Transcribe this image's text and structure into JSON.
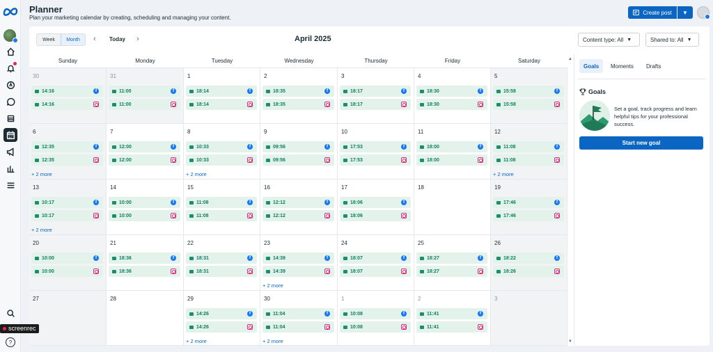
{
  "header": {
    "title": "Planner",
    "subtitle": "Plan your marketing calendar by creating, scheduling and managing your content.",
    "create_post": "Create post"
  },
  "toolbar": {
    "view_week": "Week",
    "view_month": "Month",
    "today": "Today",
    "month_label": "April 2025",
    "content_type": "Content type: All",
    "shared_to": "Shared to: All"
  },
  "weekdays": [
    "Sunday",
    "Monday",
    "Tuesday",
    "Wednesday",
    "Thursday",
    "Friday",
    "Saturday"
  ],
  "weeks": [
    [
      {
        "day": "30",
        "dim": true,
        "shade": true,
        "posts": [
          "14:16",
          "14:16"
        ]
      },
      {
        "day": "31",
        "dim": true,
        "shade": true,
        "posts": [
          "11:00",
          "11:00"
        ]
      },
      {
        "day": "1",
        "posts": [
          "18:14",
          "18:14"
        ]
      },
      {
        "day": "2",
        "posts": [
          "18:35",
          "18:35"
        ]
      },
      {
        "day": "3",
        "posts": [
          "18:17",
          "18:17"
        ]
      },
      {
        "day": "4",
        "posts": [
          "18:30",
          "18:30"
        ]
      },
      {
        "day": "5",
        "shade": true,
        "posts": [
          "15:58",
          "15:58"
        ]
      }
    ],
    [
      {
        "day": "6",
        "shade": true,
        "posts": [
          "12:35",
          "12:35"
        ],
        "more": "+ 2 more"
      },
      {
        "day": "7",
        "posts": [
          "12:00",
          "12:00"
        ]
      },
      {
        "day": "8",
        "posts": [
          "10:33",
          "10:33"
        ],
        "more": "+ 2 more"
      },
      {
        "day": "9",
        "posts": [
          "09:56",
          "09:56"
        ]
      },
      {
        "day": "10",
        "posts": [
          "17:53",
          "17:53"
        ]
      },
      {
        "day": "11",
        "posts": [
          "18:00",
          "18:00"
        ]
      },
      {
        "day": "12",
        "shade": true,
        "posts": [
          "11:08",
          "11:08"
        ],
        "more": "+ 2 more"
      }
    ],
    [
      {
        "day": "13",
        "shade": true,
        "posts": [
          "10:17",
          "10:17"
        ],
        "more": "+ 2 more"
      },
      {
        "day": "14",
        "posts": [
          "10:00",
          "10:00"
        ]
      },
      {
        "day": "15",
        "posts": [
          "11:08",
          "11:08"
        ]
      },
      {
        "day": "16",
        "posts": [
          "12:12",
          "12:12"
        ]
      },
      {
        "day": "17",
        "posts": [
          "18:06",
          "18:06"
        ]
      },
      {
        "day": "18",
        "posts": []
      },
      {
        "day": "19",
        "shade": true,
        "posts": [
          "17:46",
          "17:46"
        ]
      }
    ],
    [
      {
        "day": "20",
        "shade": true,
        "posts": [
          "10:00",
          "10:00"
        ]
      },
      {
        "day": "21",
        "posts": [
          "18:36",
          "18:36"
        ]
      },
      {
        "day": "22",
        "posts": [
          "18:31",
          "18:31"
        ]
      },
      {
        "day": "23",
        "posts": [
          "14:39",
          "14:39"
        ],
        "more": "+ 2 more"
      },
      {
        "day": "24",
        "posts": [
          "18:07",
          "18:07"
        ]
      },
      {
        "day": "25",
        "posts": [
          "18:27",
          "18:27"
        ]
      },
      {
        "day": "26",
        "shade": true,
        "posts": [
          "18:22",
          "18:26"
        ]
      }
    ],
    [
      {
        "day": "27",
        "shade": true,
        "posts": []
      },
      {
        "day": "28",
        "posts": []
      },
      {
        "day": "29",
        "posts": [
          "14:26",
          "14:26"
        ],
        "more": "+ 2 more"
      },
      {
        "day": "30",
        "posts": [
          "11:04",
          "11:04"
        ],
        "more": "+ 2 more"
      },
      {
        "day": "1",
        "dim": true,
        "posts": [
          "10:08",
          "10:08"
        ]
      },
      {
        "day": "2",
        "dim": true,
        "posts": [
          "11:41",
          "11:41"
        ]
      },
      {
        "day": "3",
        "dim": true,
        "shade": true,
        "posts": []
      }
    ]
  ],
  "right_panel": {
    "tabs": [
      "Goals",
      "Moments",
      "Drafts"
    ],
    "goals_heading": "Goals",
    "goals_text": "Set a goal, track progress and learn helpful tips for your professional success.",
    "start_goal": "Start new goal"
  },
  "recorder_label": "screenrec",
  "help_label": "?",
  "colors": {
    "accent": "#0a66c2",
    "post_bg": "#e3f3ec",
    "post_text": "#0d7d5f",
    "facebook": "#1877f2",
    "instagram": "#d62976"
  }
}
